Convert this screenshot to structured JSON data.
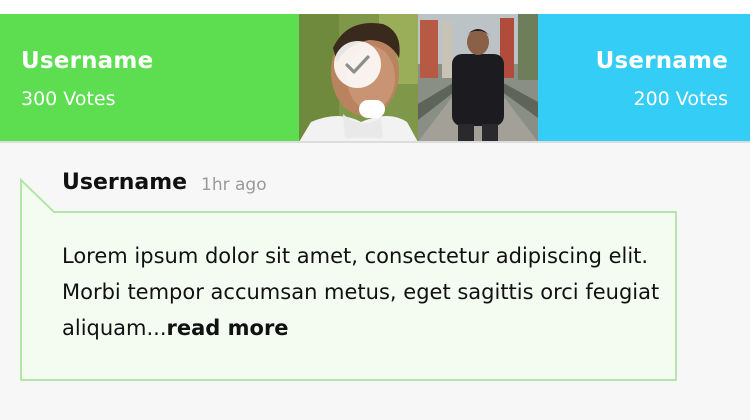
{
  "left_candidate": {
    "username": "Username",
    "votes": "300 Votes"
  },
  "right_candidate": {
    "username": "Username",
    "votes": "200 Votes"
  },
  "comment": {
    "author": "Username",
    "time": "1hr ago",
    "text": "Lorem ipsum dolor sit amet, consectetur adipiscing elit. Morbi tempor accumsan metus, eget sagittis orci feugiat aliquam...",
    "read_more": "read more"
  },
  "colors": {
    "left": "#5ddd50",
    "right": "#33cdf5",
    "bubble_border": "#b3e7a8",
    "bubble_fill": "#f4fcf2"
  },
  "icons": {
    "selected": "check-icon"
  }
}
